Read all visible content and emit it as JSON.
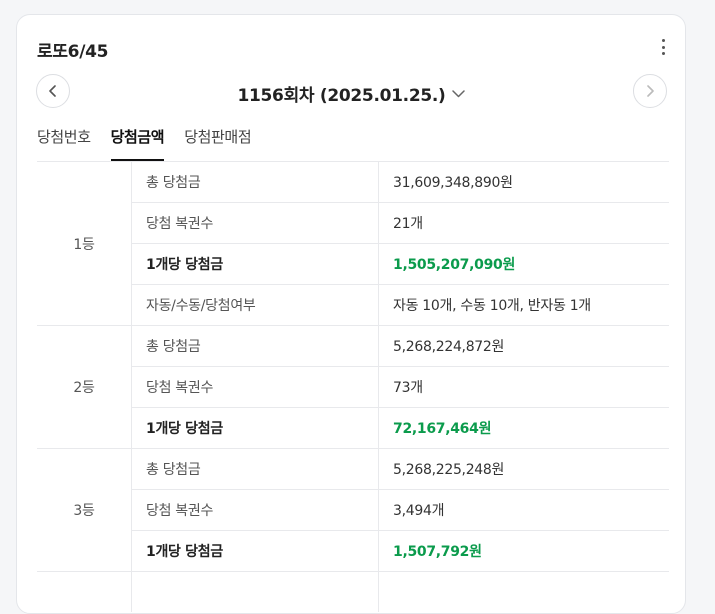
{
  "header": {
    "title": "로또6/45",
    "more_icon": "more-vertical-icon"
  },
  "round_nav": {
    "prev_icon": "chevron-left-icon",
    "next_icon": "chevron-right-icon",
    "selected_round": "1156회차 (2025.01.25.)",
    "dropdown_icon": "chevron-down-icon"
  },
  "tabs": [
    {
      "label": "당첨번호",
      "active": false
    },
    {
      "label": "당첨금액",
      "active": true
    },
    {
      "label": "당첨판매점",
      "active": false
    }
  ],
  "colors": {
    "highlight_green": "#0b9b4c",
    "text_dark": "#222222",
    "text_muted": "#555555"
  },
  "prizes": [
    {
      "rank": "1등",
      "rows": [
        {
          "label": "총 당첨금",
          "value": "31,609,348,890원"
        },
        {
          "label": "당첨 복권수",
          "value": "21개"
        },
        {
          "label": "1개당 당첨금",
          "value": "1,505,207,090원"
        },
        {
          "label": "자동/수동/당첨여부",
          "value": "자동 10개, 수동 10개, 반자동 1개"
        }
      ]
    },
    {
      "rank": "2등",
      "rows": [
        {
          "label": "총 당첨금",
          "value": "5,268,224,872원"
        },
        {
          "label": "당첨 복권수",
          "value": "73개"
        },
        {
          "label": "1개당 당첨금",
          "value": "72,167,464원"
        }
      ]
    },
    {
      "rank": "3등",
      "rows": [
        {
          "label": "총 당첨금",
          "value": "5,268,225,248원"
        },
        {
          "label": "당첨 복권수",
          "value": "3,494개"
        },
        {
          "label": "1개당 당첨금",
          "value": "1,507,792원"
        }
      ]
    }
  ]
}
